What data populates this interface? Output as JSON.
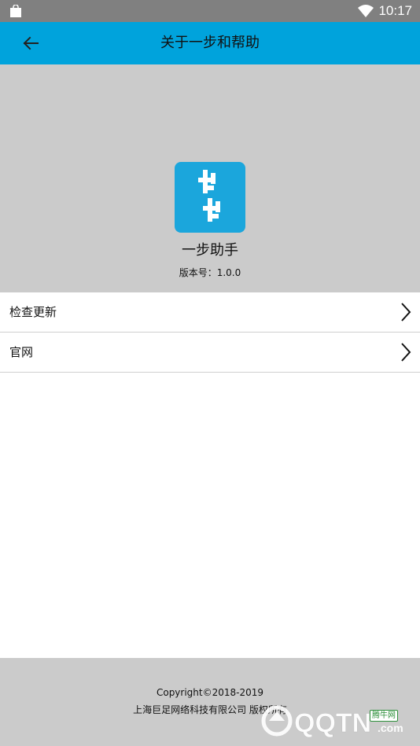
{
  "status_bar": {
    "time": "10:17",
    "icons": [
      "shopping-bag-icon",
      "wifi-icon"
    ]
  },
  "app_bar": {
    "title": "关于一步和帮助",
    "back_icon": "arrow-left-icon",
    "color": "#00a3dc"
  },
  "about": {
    "app_icon": "app-logo",
    "app_name": "一步助手",
    "version": "版本号：1.0.0"
  },
  "menu": {
    "items": [
      {
        "label": "检查更新",
        "icon": "chevron-right-icon"
      },
      {
        "label": "官网",
        "icon": "chevron-right-icon"
      }
    ]
  },
  "footer": {
    "copyright": "Copyright©2018-2019",
    "company": "上海巨足网络科技有限公司 版权所有"
  },
  "watermark": {
    "brand": "QQTN.com",
    "tag": "腾牛网"
  }
}
